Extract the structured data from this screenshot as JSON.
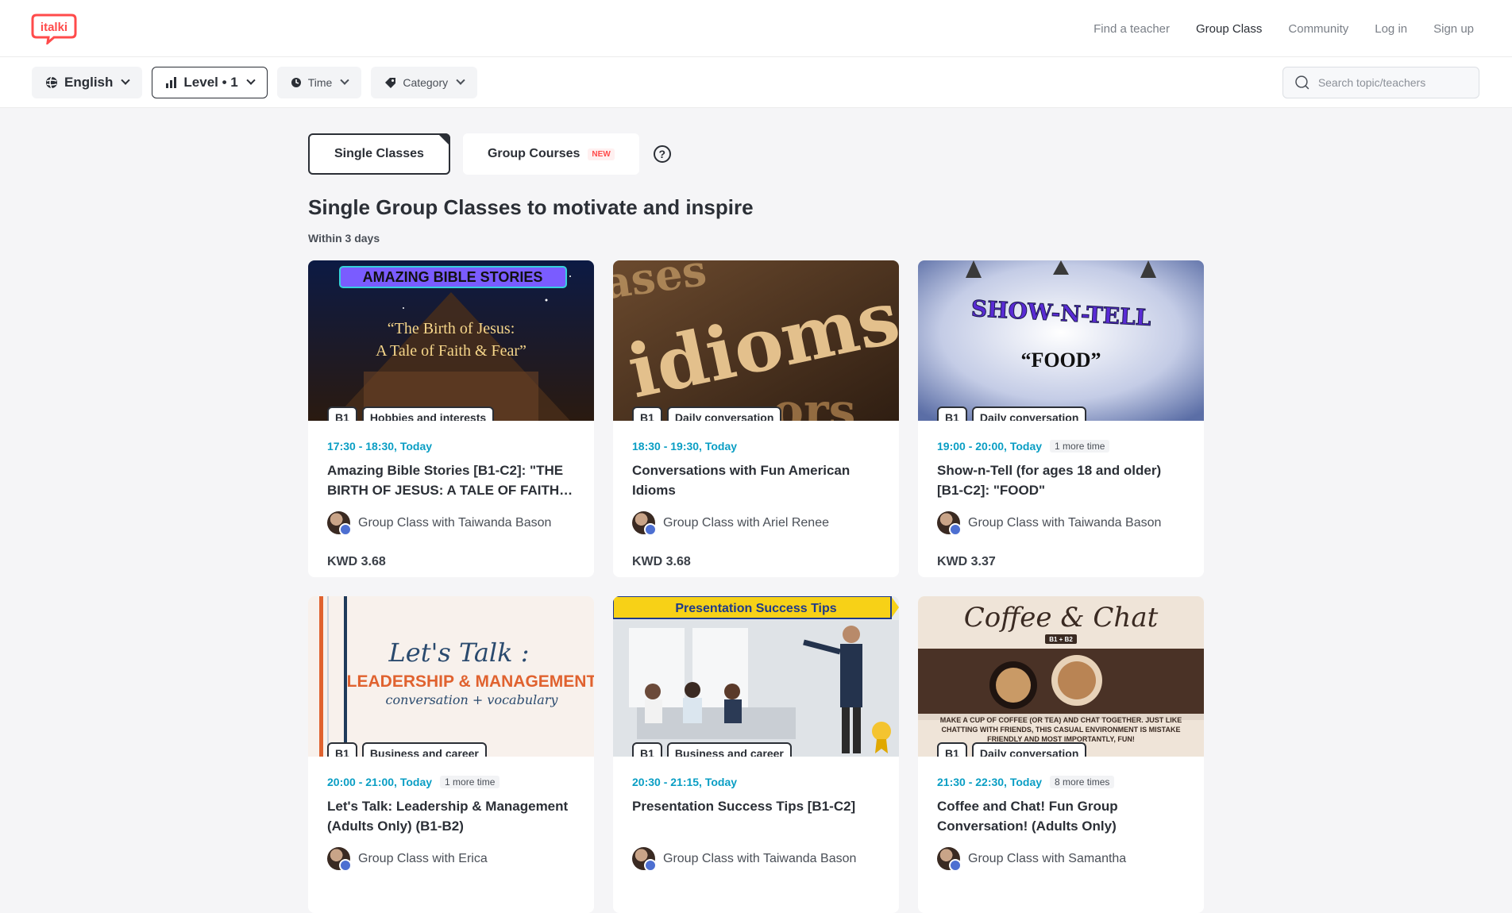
{
  "header": {
    "nav": [
      "Find a teacher",
      "Group Class",
      "Community",
      "Log in",
      "Sign up"
    ]
  },
  "filters": {
    "language": "English",
    "level": "Level • 1",
    "time": "Time",
    "category": "Category",
    "search_placeholder": "Search topic/teachers"
  },
  "tabs": {
    "single": "Single Classes",
    "courses": "Group Courses",
    "new_badge": "NEW",
    "help": "?"
  },
  "page": {
    "heading": "Single Group Classes to motivate and inspire",
    "subheading": "Within 3 days"
  },
  "thumbs": {
    "c1_banner": "AMAZING BIBLE STORIES",
    "c1_line1": "“The Birth of Jesus:",
    "c1_line2": "A Tale of Faith & Fear”",
    "c2_word": "idioms",
    "c3_title": "SHOW-N-TELL",
    "c3_sub": "“FOOD”",
    "c4_script": "Let's Talk :",
    "c4_main": "LEADERSHIP & MANAGEMENT",
    "c4_sub": "conversation + vocabulary",
    "c5_banner": "Presentation Success Tips",
    "c6_script": "Coffee & Chat",
    "c6_level": "B1 + B2",
    "c6_text": "MAKE A CUP OF COFFEE (OR TEA) AND CHAT TOGETHER. JUST LIKE CHATTING WITH FRIENDS, THIS CASUAL ENVIRONMENT IS MISTAKE FRIENDLY AND MOST IMPORTANTLY, FUN!"
  },
  "cards": [
    {
      "level": "B1",
      "category": "Hobbies and interests",
      "time": "17:30 - 18:30, Today",
      "more": "",
      "title": "Amazing Bible Stories [B1-C2]: \"THE BIRTH OF JESUS: A TALE OF FAITH &...",
      "teacher": "Group Class with Taiwanda Bason",
      "price": "KWD 3.68"
    },
    {
      "level": "B1",
      "category": "Daily conversation",
      "time": "18:30 - 19:30, Today",
      "more": "",
      "title": "Conversations with Fun American Idioms",
      "teacher": "Group Class with Ariel Renee",
      "price": "KWD 3.68"
    },
    {
      "level": "B1",
      "category": "Daily conversation",
      "time": "19:00 - 20:00, Today",
      "more": "1 more time",
      "title": "Show-n-Tell (for ages 18 and older) [B1-C2]: \"FOOD\"",
      "teacher": "Group Class with Taiwanda Bason",
      "price": "KWD 3.37"
    },
    {
      "level": "B1",
      "category": "Business and career",
      "time": "20:00 - 21:00, Today",
      "more": "1 more time",
      "title": "Let's Talk: Leadership & Management (Adults Only) (B1-B2)",
      "teacher": "Group Class with Erica",
      "price": ""
    },
    {
      "level": "B1",
      "category": "Business and career",
      "time": "20:30 - 21:15, Today",
      "more": "",
      "title": "Presentation Success Tips [B1-C2]",
      "teacher": "Group Class with Taiwanda Bason",
      "price": ""
    },
    {
      "level": "B1",
      "category": "Daily conversation",
      "time": "21:30 - 22:30, Today",
      "more": "8 more times",
      "title": "Coffee and Chat! Fun Group Conversation! (Adults Only)",
      "teacher": "Group Class with Samantha",
      "price": ""
    }
  ],
  "colors": {
    "brand_red": "#ff4b4b",
    "time_blue": "#0a9ec4",
    "text_dark": "#2b2f36",
    "page_bg": "#f5f5f7"
  }
}
